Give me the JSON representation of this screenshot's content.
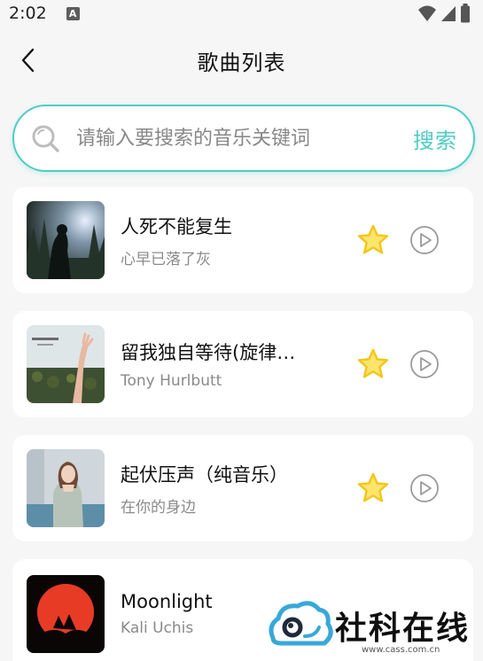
{
  "status_bar": {
    "time": "2:02",
    "notification_icon": "A"
  },
  "header": {
    "title": "歌曲列表"
  },
  "search": {
    "placeholder": "请输入要搜索的音乐关键词",
    "button_label": "搜索"
  },
  "songs": [
    {
      "title": "人死不能复生",
      "artist": "心早已落了灰",
      "cover_icon": "forest-silhouette-cover",
      "favorite_icon": "star-icon",
      "play_icon": "play-icon"
    },
    {
      "title": "留我独自等待(旋律…",
      "artist": "Tony Hurlbutt",
      "cover_icon": "hand-sunflower-cover",
      "favorite_icon": "star-icon",
      "play_icon": "play-icon"
    },
    {
      "title": "起伏压声（纯音乐）",
      "artist": "在你的身边",
      "cover_icon": "portrait-cover",
      "favorite_icon": "star-icon",
      "play_icon": "play-icon"
    },
    {
      "title": "Moonlight",
      "artist": "Kali Uchis",
      "cover_icon": "red-moon-cover"
    }
  ],
  "watermark": {
    "text": "社科在线",
    "url": "www.cass.com.cn"
  },
  "colors": {
    "accent": "#4ecdc4",
    "star": "#f5c518",
    "background": "#f6f6f7"
  }
}
